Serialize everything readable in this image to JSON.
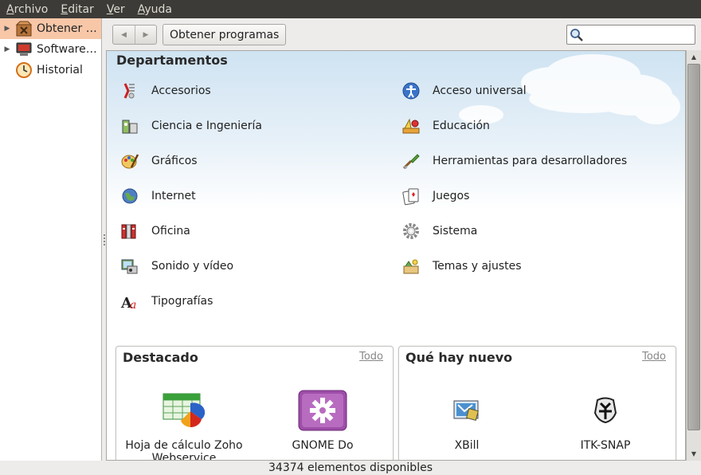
{
  "menubar": {
    "items": [
      "Archivo",
      "Editar",
      "Ver",
      "Ayuda"
    ]
  },
  "sidebar": {
    "items": [
      {
        "label": "Obtener …",
        "icon": "software-center-icon",
        "expander": true,
        "selected": true
      },
      {
        "label": "Software…",
        "icon": "installed-software-icon",
        "expander": true,
        "selected": false
      },
      {
        "label": "Historial",
        "icon": "history-clock-icon",
        "expander": false,
        "selected": false
      }
    ]
  },
  "toolbar": {
    "back_icon": "◀",
    "forward_icon": "▶",
    "breadcrumb": "Obtener programas",
    "search": {
      "value": "",
      "placeholder": ""
    }
  },
  "departments": {
    "title": "Departamentos",
    "left": [
      {
        "label": "Accesorios",
        "icon": "accessories-icon"
      },
      {
        "label": "Ciencia e Ingeniería",
        "icon": "science-icon"
      },
      {
        "label": "Gráficos",
        "icon": "graphics-icon"
      },
      {
        "label": "Internet",
        "icon": "internet-globe-icon"
      },
      {
        "label": "Oficina",
        "icon": "office-icon"
      },
      {
        "label": "Sonido y vídeo",
        "icon": "sound-video-icon"
      },
      {
        "label": "Tipografías",
        "icon": "fonts-icon"
      }
    ],
    "right": [
      {
        "label": "Acceso universal",
        "icon": "universal-access-icon"
      },
      {
        "label": "Educación",
        "icon": "education-icon"
      },
      {
        "label": "Herramientas para desarrolladores",
        "icon": "developer-tools-icon"
      },
      {
        "label": "Juegos",
        "icon": "games-icon"
      },
      {
        "label": "Sistema",
        "icon": "system-gear-icon"
      },
      {
        "label": "Temas y ajustes",
        "icon": "themes-icon"
      }
    ]
  },
  "featured": {
    "title": "Destacado",
    "link": "Todo",
    "apps": [
      {
        "name": "Hoja de cálculo Zoho Webservice",
        "icon": "spreadsheet-chart-icon"
      },
      {
        "name": "GNOME Do",
        "icon": "gnome-do-icon"
      }
    ]
  },
  "whatsnew": {
    "title": "Qué hay nuevo",
    "link": "Todo",
    "apps": [
      {
        "name": "XBill",
        "icon": "xbill-icon"
      },
      {
        "name": "ITK-SNAP",
        "icon": "itk-snap-icon"
      }
    ]
  },
  "status": {
    "text": "34374 elementos disponibles"
  },
  "colors": {
    "menubar_bg": "#3c3b37",
    "selection": "#f8c7a8",
    "sky": "#cfe3f2"
  }
}
